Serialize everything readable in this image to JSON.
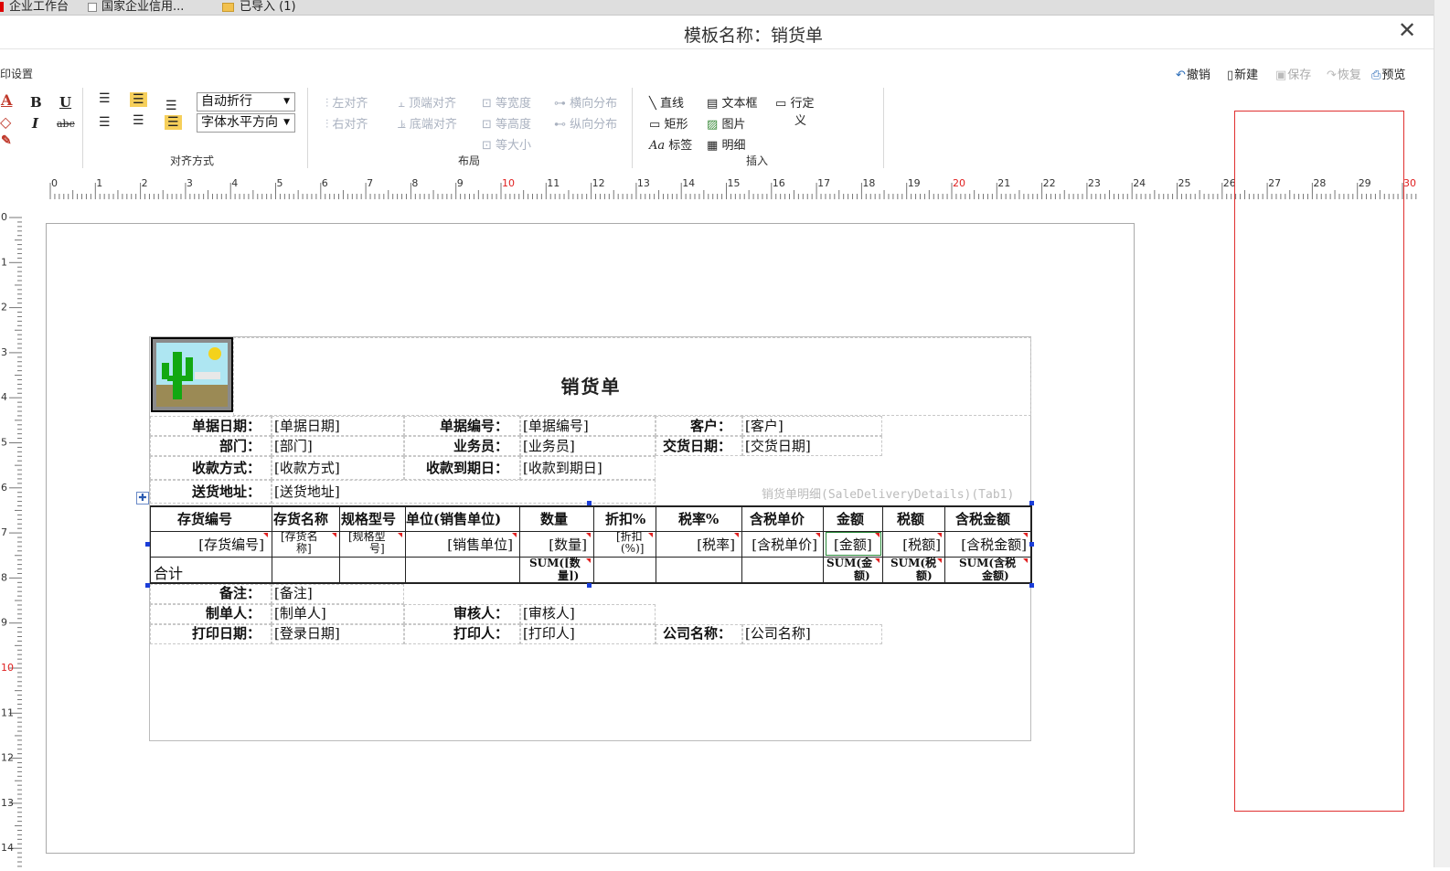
{
  "bookmarks": {
    "item1": "企业工作台",
    "item2": "国家企业信用...",
    "item3": "已导入 (1)"
  },
  "window": {
    "title": "模板名称：销货单",
    "close": "✕"
  },
  "toolbar_group_label": "印设置",
  "quick_actions": {
    "undo": "撤销",
    "new": "新建",
    "save": "保存",
    "redo": "恢复",
    "preview": "预览"
  },
  "format": {
    "wrap_mode": "自动折行",
    "h_align": "字体水平方向"
  },
  "layout_group": {
    "align_left": "左对齐",
    "align_right": "右对齐",
    "align_top": "顶端对齐",
    "align_bottom": "底端对齐",
    "same_width": "等宽度",
    "same_height": "等高度",
    "same_size": "等大小",
    "h_distribute": "横向分布",
    "v_distribute": "纵向分布"
  },
  "insert_group": {
    "line": "直线",
    "rect": "矩形",
    "label": "标签",
    "textbox": "文本框",
    "image": "图片",
    "detail": "明细",
    "row_def_1": "行定",
    "row_def_2": "义"
  },
  "group_labels": {
    "align": "对齐方式",
    "layout": "布局",
    "insert": "插入"
  },
  "ruler": {
    "h": [
      "0",
      "1",
      "2",
      "3",
      "4",
      "5",
      "6",
      "7",
      "8",
      "9",
      "10",
      "11",
      "12",
      "13",
      "14",
      "15",
      "16",
      "17",
      "18",
      "19",
      "20",
      "21",
      "22",
      "23",
      "24",
      "25",
      "26",
      "27",
      "28",
      "29",
      "30"
    ],
    "v": [
      "0",
      "1",
      "2",
      "3",
      "4",
      "5",
      "6",
      "7",
      "8",
      "9",
      "10",
      "11",
      "12",
      "13",
      "14"
    ],
    "accent": "#e02020"
  },
  "report": {
    "title": "销货单",
    "h1": {
      "l1": "单据日期：",
      "v1": "[单据日期]",
      "l2": "单据编号：",
      "v2": "[单据编号]",
      "l3": "客户：",
      "v3": "[客户]"
    },
    "h2": {
      "l1": "部门：",
      "v1": "[部门]",
      "l2": "业务员：",
      "v2": "[业务员]",
      "l3": "交货日期：",
      "v3": "[交货日期]"
    },
    "h3": {
      "l1": "收款方式：",
      "v1": "[收款方式]",
      "l2": "收款到期日：",
      "v2": "[收款到期日]"
    },
    "h4": {
      "l1": "送货地址：",
      "v1": "[送货地址]"
    },
    "table_name": "销货单明细(SaleDeliveryDetails)(Tab1)",
    "cols": [
      "存货编号",
      "存货名称",
      "规格型号",
      "单位(销售单位)",
      "数量",
      "折扣%",
      "税率%",
      "含税单价",
      "金额",
      "税额",
      "含税金额"
    ],
    "row": [
      "[存货编号]",
      "[存货名",
      "称]",
      "[规格型",
      "号]",
      "[销售单位]",
      "[数量]",
      "[折扣",
      "(%)]",
      "[税率]",
      "[含税单价]",
      "[金额]",
      "[税额]",
      "[含税金额]"
    ],
    "total": {
      "label": "合计",
      "qty1": "SUM([数",
      "qty2": "量])",
      "amt1": "SUM(金",
      "amt2": "额)",
      "tax1": "SUM(税",
      "tax2": "额)",
      "tot1": "SUM(含税",
      "tot2": "金额)"
    },
    "f1": {
      "l1": "备注：",
      "v1": "[备注]"
    },
    "f2": {
      "l1": "制单人：",
      "v1": "[制单人]",
      "l2": "审核人：",
      "v2": "[审核人]"
    },
    "f3": {
      "l1": "打印日期：",
      "v1": "[登录日期]",
      "l2": "打印人：",
      "v2": "[打印人]",
      "l3": "公司名称：",
      "v3": "[公司名称]"
    }
  }
}
